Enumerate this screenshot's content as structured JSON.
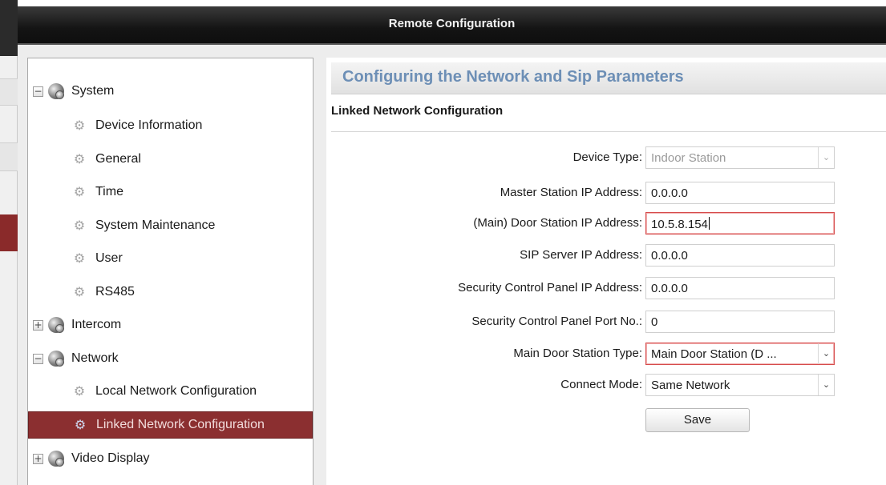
{
  "window": {
    "title": "Remote Configuration"
  },
  "tree": {
    "items": [
      {
        "label": "System",
        "level": 0,
        "expander": "−",
        "icon": "globe-icon"
      },
      {
        "label": "Device Information",
        "level": 1,
        "icon": "gear-icon"
      },
      {
        "label": "General",
        "level": 1,
        "icon": "gear-icon"
      },
      {
        "label": "Time",
        "level": 1,
        "icon": "gear-icon"
      },
      {
        "label": "System Maintenance",
        "level": 1,
        "icon": "gear-icon"
      },
      {
        "label": "User",
        "level": 1,
        "icon": "gear-icon"
      },
      {
        "label": "RS485",
        "level": 1,
        "icon": "gear-icon"
      },
      {
        "label": "Intercom",
        "level": 0,
        "expander": "+",
        "icon": "globe-icon"
      },
      {
        "label": "Network",
        "level": 0,
        "expander": "−",
        "icon": "globe-icon"
      },
      {
        "label": "Local Network Configuration",
        "level": 1,
        "icon": "gear-icon"
      },
      {
        "label": "Linked Network Configuration",
        "level": 1,
        "icon": "gear-icon",
        "selected": true
      },
      {
        "label": "Video Display",
        "level": 0,
        "expander": "+",
        "icon": "globe-icon"
      }
    ]
  },
  "content": {
    "heading": "Configuring the Network and Sip Parameters",
    "section_title": "Linked Network Configuration",
    "fields": {
      "device_type": {
        "label": "Device Type:",
        "value": "Indoor Station"
      },
      "master_ip": {
        "label": "Master Station IP Address:",
        "value": "0.0.0.0"
      },
      "main_door_ip": {
        "label": "(Main) Door Station IP Address:",
        "value": "10.5.8.154"
      },
      "sip_ip": {
        "label": "SIP Server IP Address:",
        "value": "0.0.0.0"
      },
      "scp_ip": {
        "label": "Security Control Panel IP Address:",
        "value": "0.0.0.0"
      },
      "scp_port": {
        "label": "Security Control Panel Port No.:",
        "value": "0"
      },
      "main_door_type": {
        "label": "Main Door Station Type:",
        "value": "Main Door Station (D ..."
      },
      "connect_mode": {
        "label": "Connect Mode:",
        "value": "Same Network"
      }
    },
    "save_label": "Save"
  },
  "colors": {
    "selection": "#8b2f30",
    "heading_text": "#6d8fb6",
    "focus_border": "#d64b4b"
  }
}
